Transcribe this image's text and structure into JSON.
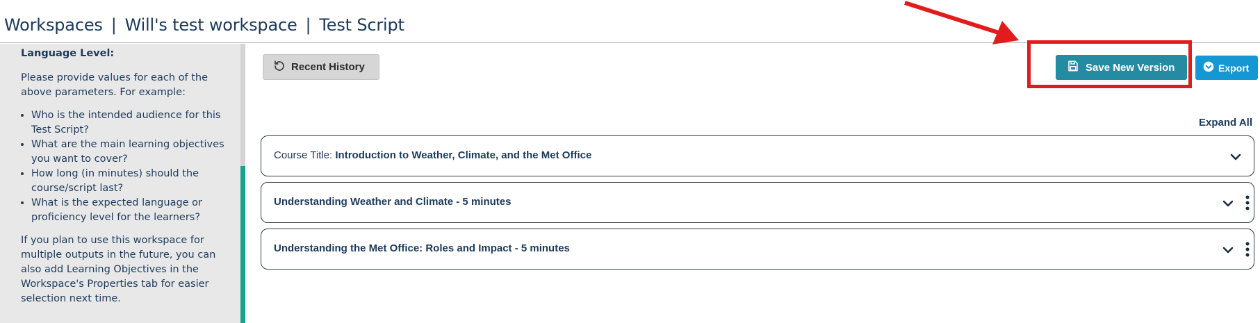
{
  "breadcrumb": {
    "workspaces": "Workspaces",
    "workspace": "Will's test workspace",
    "script": "Test Script",
    "separator": "|"
  },
  "sidebar": {
    "heading": "Language Level:",
    "intro": "Please provide values for each of the above parameters. For example:",
    "bullets": [
      "Who is the intended audience for this Test Script?",
      "What are the main learning objectives you want to cover?",
      "How long (in minutes) should the course/script last?",
      "What is the expected language or proficiency level for the learners?"
    ],
    "footer": "If you plan to use this workspace for multiple outputs in the future, you can also add Learning Objectives in the Workspace's Properties tab for easier selection next time."
  },
  "toolbar": {
    "recent_history_label": "Recent History",
    "save_label": "Save New Version",
    "export_label": "Export"
  },
  "expand_all_label": "Expand All",
  "cards": [
    {
      "prefix": "Course Title:",
      "title": "Introduction to Weather, Climate, and the Met Office"
    },
    {
      "prefix": "",
      "title": "Understanding Weather and Climate - 5 minutes"
    },
    {
      "prefix": "",
      "title": "Understanding the Met Office: Roles and Impact - 5 minutes"
    }
  ],
  "colors": {
    "save_button": "#258ba3",
    "export_button": "#1597d3",
    "highlight": "#e21c1c",
    "scroll_thumb": "#1aa08e"
  }
}
